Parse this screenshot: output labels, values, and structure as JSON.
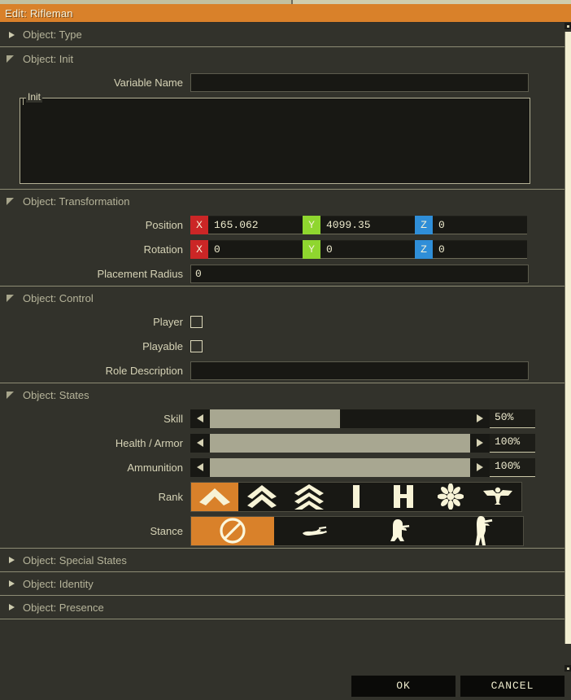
{
  "window": {
    "title": "Edit: Rifleman",
    "accent_color": "#d9812a",
    "background_color": "#32322b",
    "text_color": "#d6d3b6"
  },
  "sections": {
    "type": {
      "label": "Object: Type",
      "state": "collapsed"
    },
    "init": {
      "label": "Object: Init",
      "state": "expanded"
    },
    "transformation": {
      "label": "Object: Transformation",
      "state": "expanded"
    },
    "control": {
      "label": "Object: Control",
      "state": "expanded"
    },
    "states": {
      "label": "Object: States",
      "state": "expanded"
    },
    "special_states": {
      "label": "Object: Special States",
      "state": "collapsed"
    },
    "identity": {
      "label": "Object: Identity",
      "state": "collapsed"
    },
    "presence": {
      "label": "Object: Presence",
      "state": "collapsed"
    }
  },
  "init": {
    "variable_name_label": "Variable Name",
    "variable_name_value": "",
    "init_group_label": "Init",
    "init_value": ""
  },
  "transformation": {
    "position_label": "Position",
    "position": {
      "x": "165.062",
      "y": "4099.35",
      "z": "0"
    },
    "rotation_label": "Rotation",
    "rotation": {
      "x": "0",
      "y": "0",
      "z": "0"
    },
    "placement_radius_label": "Placement Radius",
    "placement_radius": "0",
    "axis_labels": {
      "x": "X",
      "y": "Y",
      "z": "Z"
    },
    "axis_colors": {
      "x": "#cb2626",
      "y": "#8fd62f",
      "z": "#2f8ed8"
    }
  },
  "control": {
    "player_label": "Player",
    "player_checked": false,
    "playable_label": "Playable",
    "playable_checked": false,
    "role_description_label": "Role Description",
    "role_description_value": ""
  },
  "states": {
    "sliders": [
      {
        "label": "Skill",
        "value": "50%",
        "percent": 50
      },
      {
        "label": "Health / Armor",
        "value": "100%",
        "percent": 100
      },
      {
        "label": "Ammunition",
        "value": "100%",
        "percent": 100
      }
    ],
    "rank_label": "Rank",
    "rank_options": [
      {
        "icon": "rank-private-chevron-icon",
        "selected": true
      },
      {
        "icon": "rank-corporal-double-chevron-icon",
        "selected": false
      },
      {
        "icon": "rank-sergeant-triple-chevron-icon",
        "selected": false
      },
      {
        "icon": "rank-lieutenant-bar-icon",
        "selected": false
      },
      {
        "icon": "rank-captain-double-bar-icon",
        "selected": false
      },
      {
        "icon": "rank-major-star-icon",
        "selected": false
      },
      {
        "icon": "rank-colonel-eagle-icon",
        "selected": false
      }
    ],
    "stance_label": "Stance",
    "stance_options": [
      {
        "icon": "stance-none-icon",
        "selected": true
      },
      {
        "icon": "stance-prone-icon",
        "selected": false
      },
      {
        "icon": "stance-crouch-icon",
        "selected": false
      },
      {
        "icon": "stance-stand-icon",
        "selected": false
      }
    ]
  },
  "footer": {
    "ok_label": "OK",
    "cancel_label": "CANCEL"
  },
  "scrollbar": {
    "up_icon": "scroll-up-icon",
    "down_icon": "scroll-down-icon"
  }
}
